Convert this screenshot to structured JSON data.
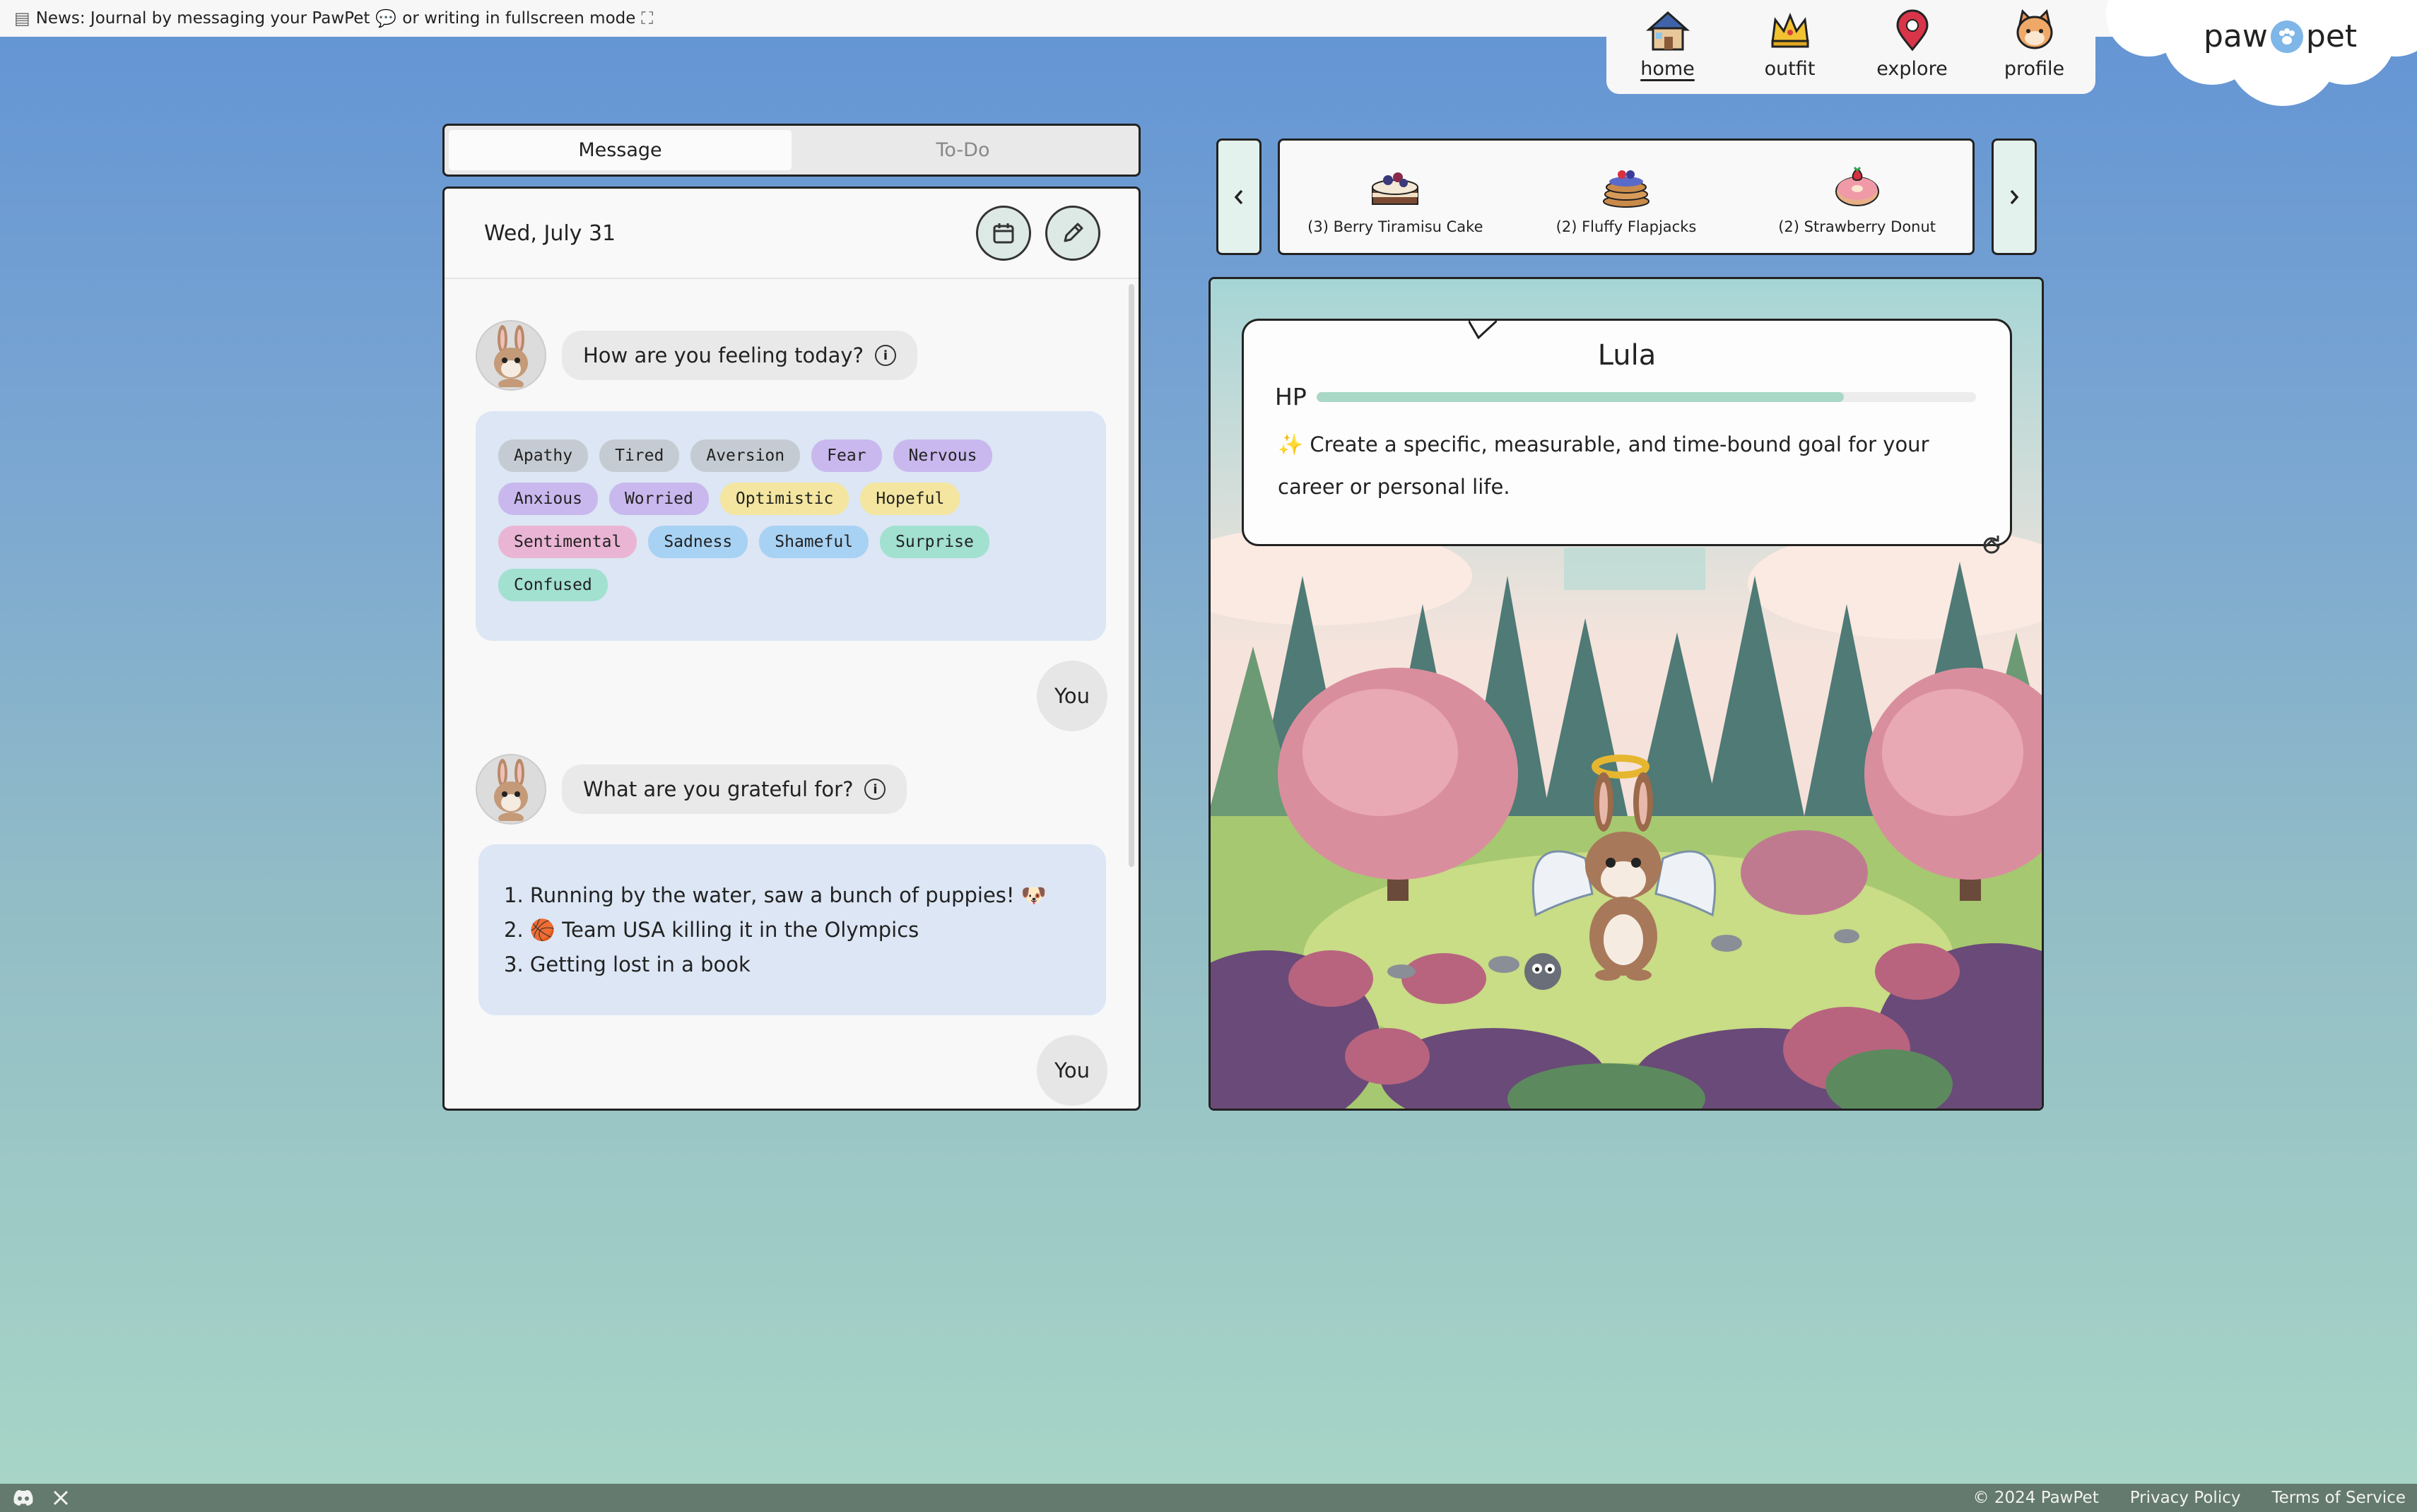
{
  "news": {
    "label": "News:",
    "text_before": "Journal by messaging your PawPet",
    "text_mid": "or writing in fullscreen mode"
  },
  "nav": {
    "items": [
      {
        "label": "home",
        "icon": "house-icon",
        "active": true
      },
      {
        "label": "outfit",
        "icon": "crown-icon",
        "active": false
      },
      {
        "label": "explore",
        "icon": "map-pin-icon",
        "active": false
      },
      {
        "label": "profile",
        "icon": "cat-face-icon",
        "active": false
      }
    ]
  },
  "logo": {
    "left": "paw",
    "right": "pet"
  },
  "tabs": {
    "message": "Message",
    "todo": "To-Do"
  },
  "chat": {
    "date": "Wed, July 31",
    "prompt1": "How are you feeling today?",
    "feelings": [
      {
        "label": "Apathy",
        "tone": "gray"
      },
      {
        "label": "Tired",
        "tone": "gray"
      },
      {
        "label": "Aversion",
        "tone": "gray"
      },
      {
        "label": "Fear",
        "tone": "purple"
      },
      {
        "label": "Nervous",
        "tone": "purple"
      },
      {
        "label": "Anxious",
        "tone": "purple"
      },
      {
        "label": "Worried",
        "tone": "purple"
      },
      {
        "label": "Optimistic",
        "tone": "yellow"
      },
      {
        "label": "Hopeful",
        "tone": "yellow"
      },
      {
        "label": "Sentimental",
        "tone": "pink"
      },
      {
        "label": "Sadness",
        "tone": "blue"
      },
      {
        "label": "Shameful",
        "tone": "blue"
      },
      {
        "label": "Surprise",
        "tone": "teal"
      },
      {
        "label": "Confused",
        "tone": "teal"
      }
    ],
    "you_label": "You",
    "prompt2": "What are you grateful for?",
    "grateful": [
      "1. Running by the water, saw a bunch of puppies! 🐶",
      "2. 🏀 Team USA killing it in the Olympics",
      "3. Getting lost in a book"
    ]
  },
  "treats": [
    {
      "label": "(3) Berry Tiramisu Cake",
      "icon": "cake-icon"
    },
    {
      "label": "(2) Fluffy Flapjacks",
      "icon": "pancakes-icon"
    },
    {
      "label": "(2) Strawberry Donut",
      "icon": "donut-icon"
    }
  ],
  "pet": {
    "name": "Lula",
    "hp_label": "HP",
    "hp_fraction": 0.8,
    "goal_icon": "✨",
    "goal": "Create a specific, measurable, and time-bound goal for your career or personal life."
  },
  "footer": {
    "copyright": "© 2024 PawPet",
    "privacy": "Privacy Policy",
    "terms": "Terms of Service"
  },
  "colors": {
    "accent": "#6394d4",
    "hp": "#a9d8c6",
    "chat_bubble": "#dce6f4"
  }
}
